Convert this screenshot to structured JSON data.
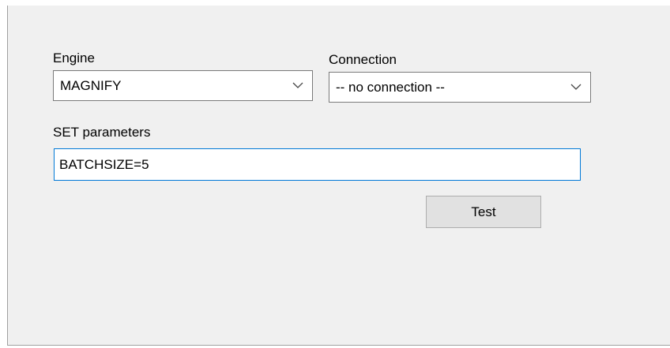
{
  "engine": {
    "label": "Engine",
    "selected": "MAGNIFY"
  },
  "connection": {
    "label": "Connection",
    "selected": "-- no connection --"
  },
  "set_parameters": {
    "label": "SET parameters",
    "value": "BATCHSIZE=5"
  },
  "test_button": {
    "label": "Test"
  }
}
